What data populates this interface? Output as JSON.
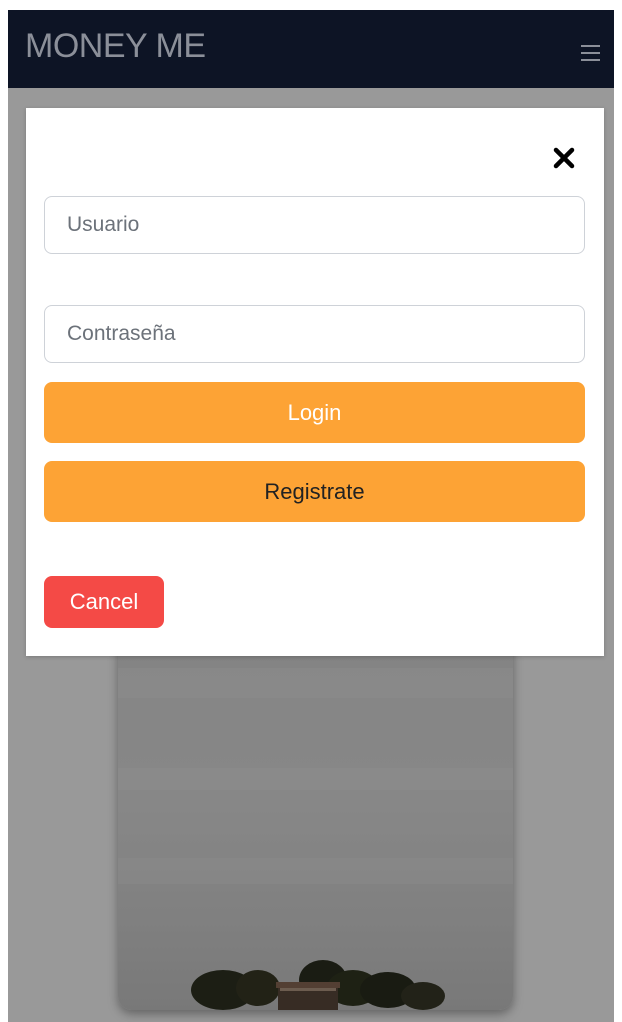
{
  "navbar": {
    "brand": "MONEY ME",
    "menu_icon": "hamburger-menu-icon"
  },
  "login_modal": {
    "close_icon": "close-icon",
    "username": {
      "placeholder": "Usuario",
      "value": ""
    },
    "password": {
      "placeholder": "Contraseña",
      "value": ""
    },
    "login_label": "Login",
    "register_label": "Registrate",
    "cancel_label": "Cancel"
  },
  "colors": {
    "navbar_bg": "#0d1425",
    "brand_text": "#8b8f99",
    "primary_button": "#fda335",
    "cancel_button": "#f44a46",
    "overlay": "rgba(0,0,0,0.4)"
  }
}
